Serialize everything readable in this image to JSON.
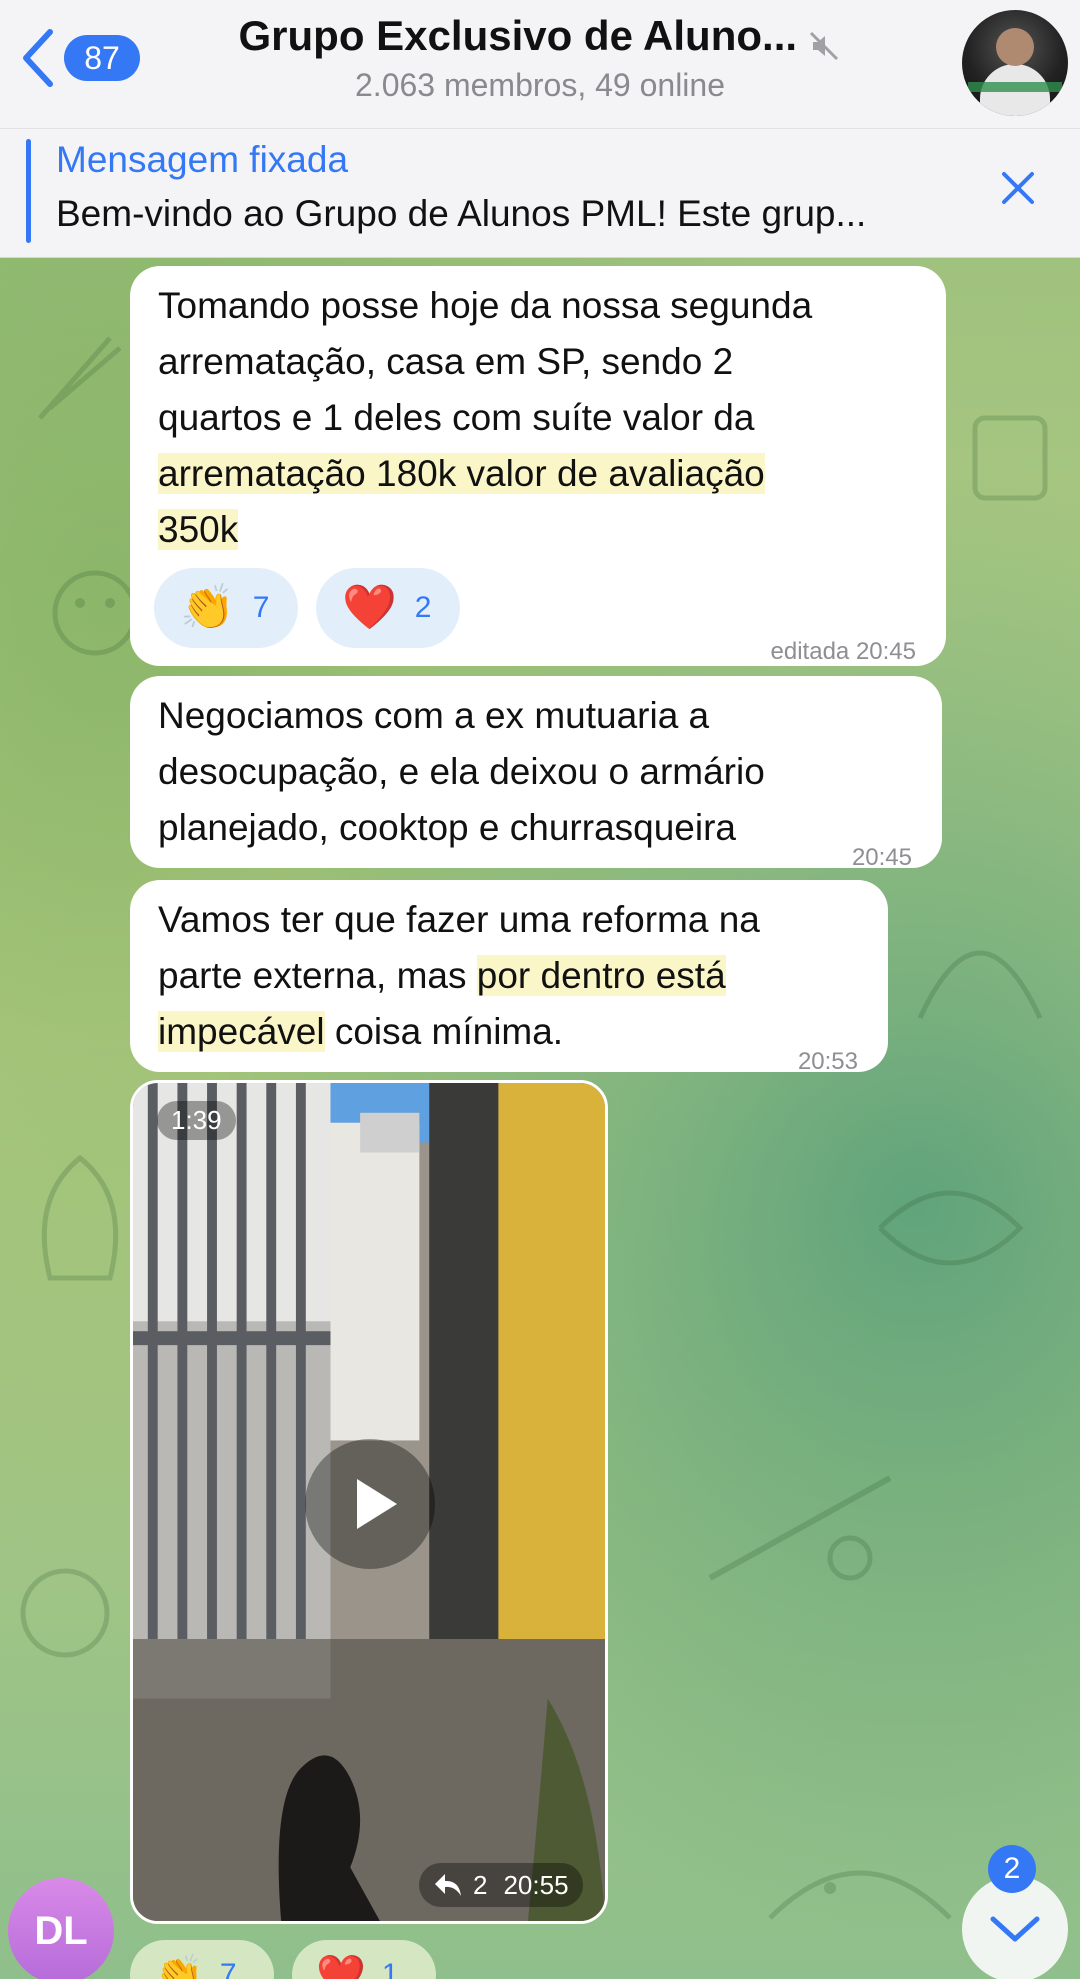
{
  "header": {
    "back_count": "87",
    "title": "Grupo Exclusivo de Aluno...",
    "subtitle": "2.063 membros, 49 online"
  },
  "pinned": {
    "label": "Mensagem fixada",
    "text": "Bem-vindo ao Grupo de Alunos PML! Este grup..."
  },
  "messages": [
    {
      "lines": [
        "Tomando posse hoje da nossa segunda",
        "arrematação, casa em SP, sendo 2",
        "quartos e 1 deles com suíte valor da",
        "arrematação 180k valor de avaliação",
        "350k"
      ],
      "reactions": [
        {
          "emoji": "👏",
          "count": "7"
        },
        {
          "emoji": "❤️",
          "count": "2"
        }
      ],
      "time": "editada 20:45"
    },
    {
      "lines": [
        "Negociamos com a ex mutuaria a",
        "desocupação, e ela deixou o armário",
        "planejado, cooktop e churrasqueira"
      ],
      "time": "20:45"
    },
    {
      "line1": "Vamos ter que fazer uma reforma na",
      "line2_plain": "parte externa, mas ",
      "line2_hl": "por dentro está",
      "line3_hl": "impecável",
      "line3_plain": " coisa mínima.",
      "time": "20:53"
    }
  ],
  "video": {
    "duration": "1:39",
    "replies": "2",
    "time": "20:55"
  },
  "bottom_reactions": [
    {
      "emoji": "👏",
      "count": "7"
    },
    {
      "emoji": "❤️",
      "count": "1"
    }
  ],
  "sender_avatar": "DL",
  "scroll_badge": "2",
  "colors": {
    "accent": "#3478f6",
    "highlight": "#fbf6c7",
    "bubble": "#ffffff"
  }
}
